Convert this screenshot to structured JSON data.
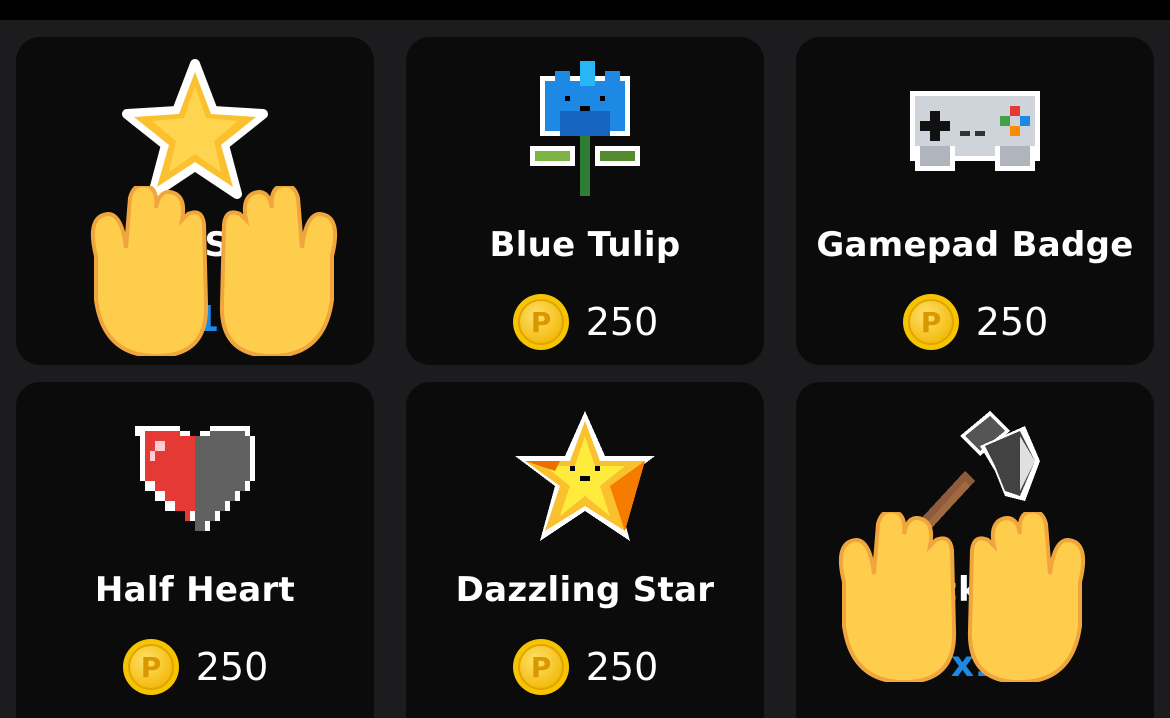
{
  "currency_icon": "gold-p-coin-icon",
  "items": [
    {
      "name": "Gold Star",
      "art_icon": "gold-star-icon",
      "price": "",
      "qty": "x1",
      "claimed": true
    },
    {
      "name": "Blue Tulip",
      "art_icon": "pixel-blue-tulip-icon",
      "price": "250"
    },
    {
      "name": "Gamepad Badge",
      "art_icon": "pixel-gamepad-icon",
      "price": "250"
    },
    {
      "name": "Half Heart",
      "art_icon": "pixel-half-heart-icon",
      "price": "250"
    },
    {
      "name": "Dazzling Star",
      "art_icon": "pixel-dazzling-star-icon",
      "price": "250"
    },
    {
      "name": "Pickaxe",
      "art_icon": "pixel-axe-icon",
      "price": "",
      "qty": "x1",
      "claimed": true
    }
  ],
  "overlay_icon": "raising-hands-icon",
  "colors": {
    "background": "#1c1c1e",
    "card": "#0b0b0b",
    "coin": "#f5c518",
    "qty": "#1e88e5"
  }
}
